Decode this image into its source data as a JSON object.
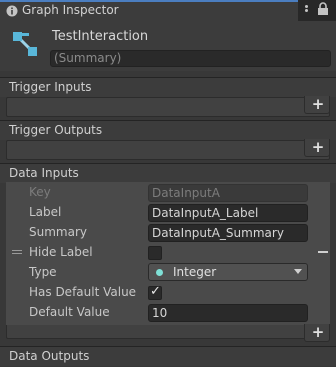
{
  "window": {
    "tab_title": "Graph Inspector",
    "tab_icon": "info-icon",
    "menu_icon": "kebab-menu-icon",
    "lock_icon": "lock-icon",
    "accent": "#4b7ec0"
  },
  "graph": {
    "icon": "graph-node-icon",
    "icon_color": "#59b7d9",
    "title": "TestInteraction",
    "summary_placeholder": "(Summary)"
  },
  "sections": {
    "trigger_inputs": {
      "label": "Trigger Inputs",
      "add_label": "+"
    },
    "trigger_outputs": {
      "label": "Trigger Outputs",
      "add_label": "+"
    },
    "data_inputs": {
      "label": "Data Inputs",
      "add_label": "+"
    },
    "data_outputs": {
      "label": "Data Outputs"
    }
  },
  "data_input_item": {
    "key_label": "Key",
    "key_value": "DataInputA",
    "label_label": "Label",
    "label_value": "DataInputA_Label",
    "summary_label": "Summary",
    "summary_value": "DataInputA_Summary",
    "hide_label_label": "Hide Label",
    "hide_label_checked": false,
    "type_label": "Type",
    "type_value": "Integer",
    "type_dot_color": "#7fe0d6",
    "has_default_label": "Has Default Value",
    "has_default_checked": true,
    "has_default_check": "✓",
    "default_value_label": "Default Value",
    "default_value": "10",
    "remove_label": "−"
  }
}
